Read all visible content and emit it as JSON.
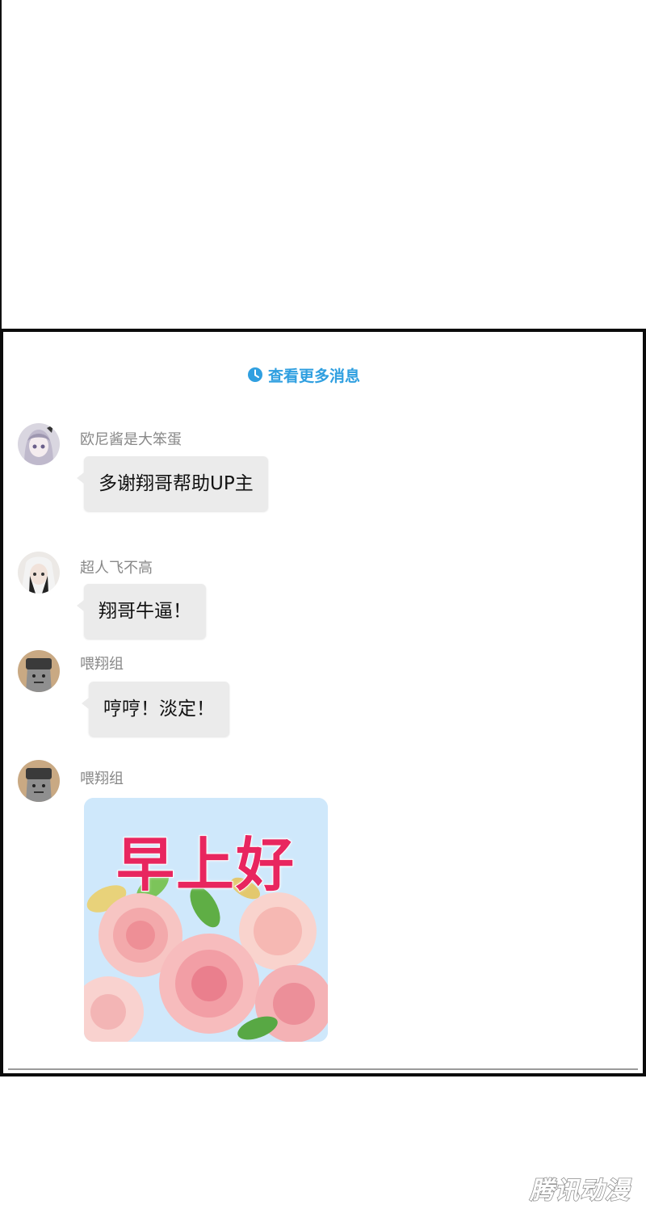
{
  "chat": {
    "more_messages_label": "查看更多消息",
    "messages": [
      {
        "nickname": "欧尼酱是大笨蛋",
        "text": "多谢翔哥帮助UP主",
        "avatar": "silver-hair-girl-avatar"
      },
      {
        "nickname": "超人飞不高",
        "text": "翔哥牛逼！",
        "avatar": "white-hair-avatar"
      },
      {
        "nickname": "喂翔组",
        "text": "哼哼！淡定！",
        "avatar": "hat-guy-avatar"
      },
      {
        "nickname": "喂翔组",
        "sticker_text": "早上好",
        "sticker": "roses-sticker",
        "avatar": "hat-guy-avatar"
      }
    ]
  },
  "watermark": "腾讯动漫",
  "colors": {
    "link": "#2f9fe0",
    "bubble": "#ebebeb",
    "sticker_text": "#e8265f",
    "frame": "#0b0b0b"
  }
}
